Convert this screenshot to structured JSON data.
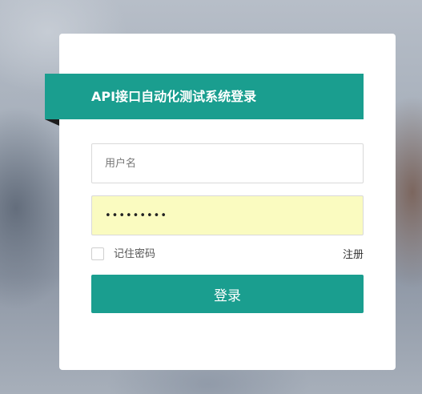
{
  "login": {
    "title": "API接口自动化测试系统登录",
    "username": {
      "placeholder": "用户名",
      "value": ""
    },
    "password": {
      "value": "•••••••••"
    },
    "remember_label": "记住密码",
    "remember_checked": false,
    "register_label": "注册",
    "submit_label": "登录"
  },
  "colors": {
    "accent": "#1a9e8f",
    "autofill_bg": "#fafbc0"
  }
}
